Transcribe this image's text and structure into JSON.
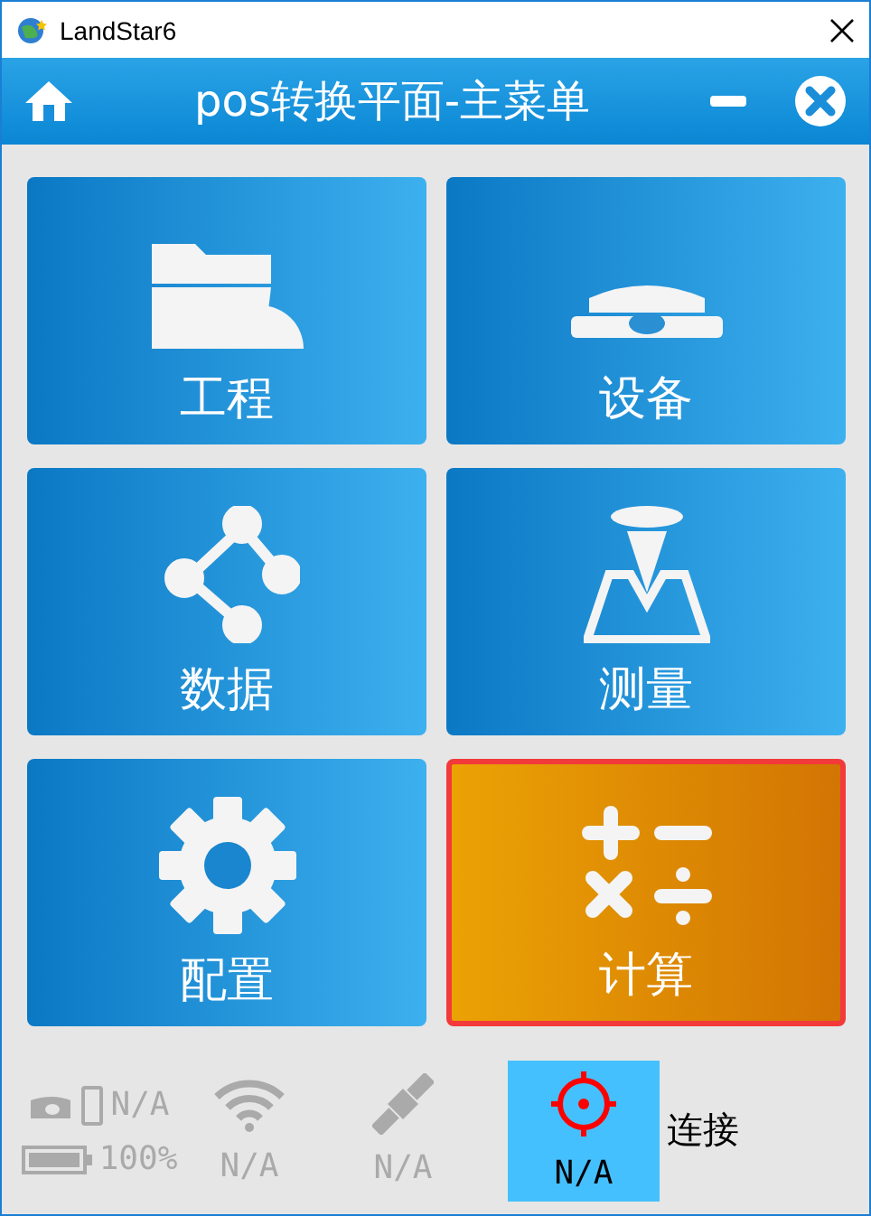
{
  "window": {
    "title": "LandStar6"
  },
  "header": {
    "title": "pos转换平面-主菜单"
  },
  "tiles": [
    {
      "label": "工程",
      "selected": false
    },
    {
      "label": "设备",
      "selected": false
    },
    {
      "label": "数据",
      "selected": false
    },
    {
      "label": "测量",
      "selected": false
    },
    {
      "label": "配置",
      "selected": false
    },
    {
      "label": "计算",
      "selected": true
    }
  ],
  "status_bar": {
    "receiver_battery": "N/A",
    "controller_battery": "100%",
    "wifi": "N/A",
    "satellites": "N/A",
    "position": "N/A",
    "connect": "连接"
  }
}
